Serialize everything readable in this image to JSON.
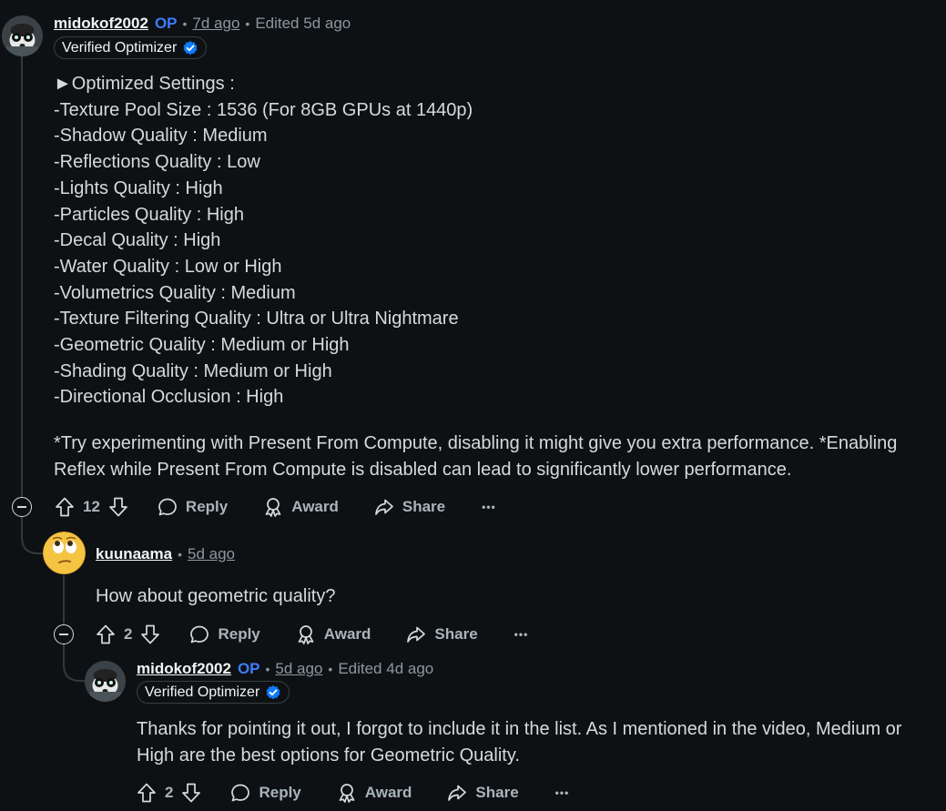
{
  "comment1": {
    "username": "midokof2002",
    "op": "OP",
    "time": "7d ago",
    "edited": "Edited 5d ago",
    "flair": "Verified Optimizer",
    "lines": [
      "►Optimized Settings :",
      "-Texture Pool Size : 1536 (For 8GB GPUs at 1440p)",
      "-Shadow Quality : Medium",
      "-Reflections Quality : Low",
      "-Lights Quality : High",
      "-Particles Quality : High",
      "-Decal Quality : High",
      "-Water Quality : Low or High",
      "-Volumetrics Quality : Medium",
      "-Texture Filtering Quality : Ultra or Ultra Nightmare",
      "-Geometric Quality : Medium or High",
      "-Shading Quality : Medium or High",
      "-Directional Occlusion : High"
    ],
    "note": "*Try experimenting with Present From Compute, disabling it might give you extra performance. *Enabling Reflex while Present From Compute is disabled can lead to significantly lower performance.",
    "votes": "12"
  },
  "comment2": {
    "username": "kuunaama",
    "time": "5d ago",
    "text": "How about geometric quality?",
    "votes": "2"
  },
  "comment3": {
    "username": "midokof2002",
    "op": "OP",
    "time": "5d ago",
    "edited": "Edited 4d ago",
    "flair": "Verified Optimizer",
    "text": "Thanks for pointing it out, I forgot to include it in the list. As I mentioned in the video, Medium or High are the best options for Geometric Quality.",
    "votes": "2"
  },
  "actions": {
    "reply": "Reply",
    "award": "Award",
    "share": "Share",
    "more": "•••"
  },
  "separator": "•",
  "colors": {
    "background": "#0e1113",
    "op": "#3d7bff",
    "verified": "#0f7bff"
  }
}
